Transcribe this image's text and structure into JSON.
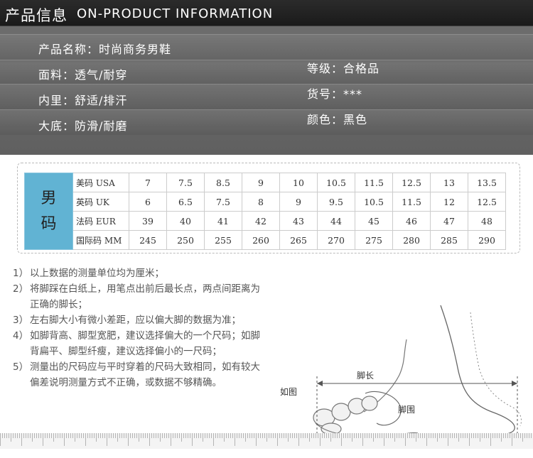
{
  "header": {
    "title_cn": "产品信息",
    "title_en": "ON-PRODUCT INFORMATION"
  },
  "info": {
    "name": "产品名称：时尚商务男鞋",
    "material": "面料：透气/耐穿",
    "lining": "内里：舒适/排汗",
    "sole": "大底：防滑/耐磨",
    "grade": "等级：合格品",
    "item_no": "货号：***",
    "color": "颜色：黑色"
  },
  "size_chart": {
    "side_label": [
      "男",
      "码"
    ],
    "rows": [
      {
        "label": "美码 USA",
        "values": [
          "7",
          "7.5",
          "8.5",
          "9",
          "10",
          "10.5",
          "11.5",
          "12.5",
          "13",
          "13.5"
        ]
      },
      {
        "label": "英码 UK",
        "values": [
          "6",
          "6.5",
          "7.5",
          "8",
          "9",
          "9.5",
          "10.5",
          "11.5",
          "12",
          "12.5"
        ]
      },
      {
        "label": "法码 EUR",
        "values": [
          "39",
          "40",
          "41",
          "42",
          "43",
          "44",
          "45",
          "46",
          "47",
          "48"
        ]
      },
      {
        "label": "国际码 MM",
        "values": [
          "245",
          "250",
          "255",
          "260",
          "265",
          "270",
          "275",
          "280",
          "285",
          "290"
        ]
      }
    ]
  },
  "notes": [
    {
      "num": "1）",
      "text": "以上数据的测量单位均为厘米；"
    },
    {
      "num": "2）",
      "text": "将脚踩在白纸上，用笔点出前后最长点，两点间距离为正确的脚长；"
    },
    {
      "num": "3）",
      "text": "左右脚大小有微小差距，应以偏大脚的数据为准；"
    },
    {
      "num": "4）",
      "text": "如脚背高、脚型宽肥，建议选择偏大的一个尺码；如脚背扁平、脚型纤瘦，建议选择偏小的一尺码；"
    },
    {
      "num": "5）",
      "text": "测量出的尺码应与平时穿着的尺码大致相同，如有较大偏差说明测量方式不正确，或数据不够精确。"
    }
  ],
  "diagram": {
    "example_label": "如图",
    "length_label": "脚长",
    "girth_label": "脚围"
  }
}
